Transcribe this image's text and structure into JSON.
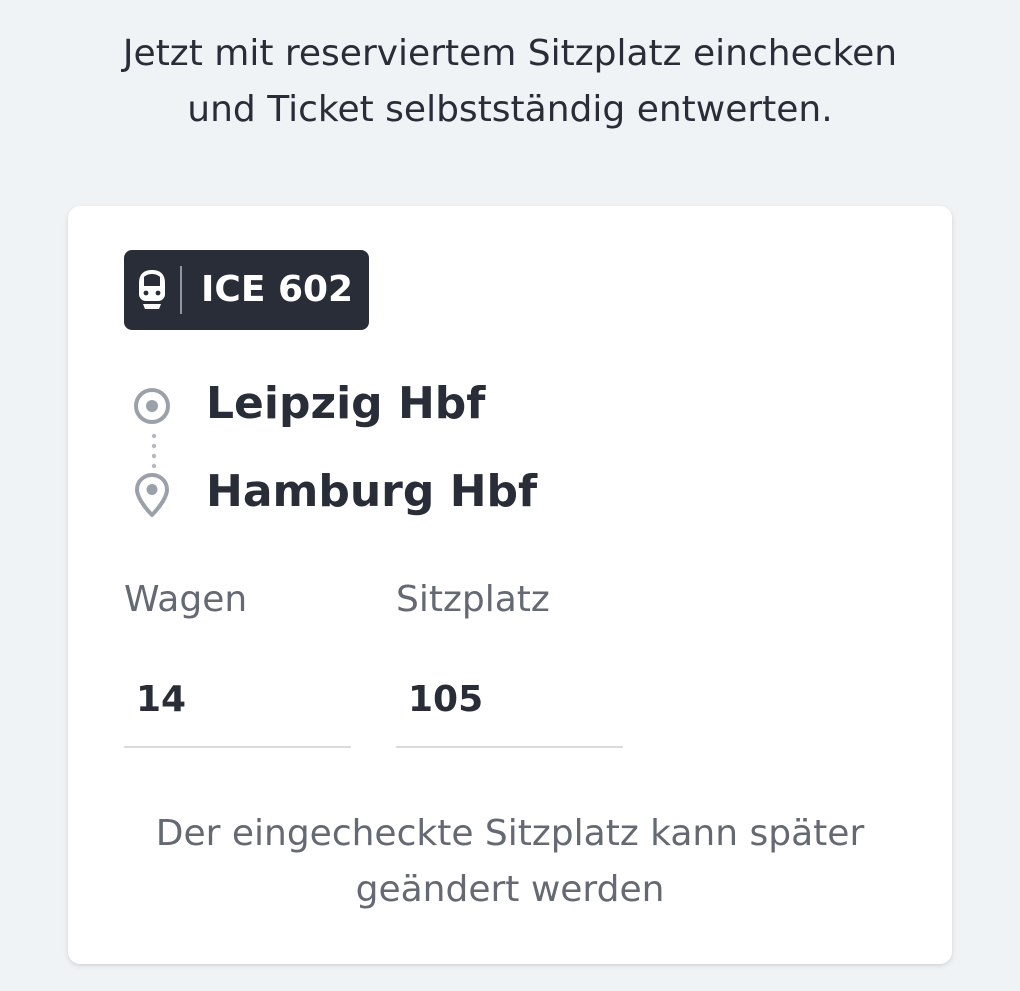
{
  "intro": {
    "line1": "Jetzt mit reserviertem Sitzplatz einchecken",
    "line2": "und Ticket selbstständig entwerten."
  },
  "card": {
    "train": {
      "icon": "train-front-icon",
      "name": "ICE 602"
    },
    "route": {
      "origin_icon": "origin-circle-icon",
      "origin": "Leipzig Hbf",
      "destination_icon": "location-pin-icon",
      "destination": "Hamburg Hbf"
    },
    "wagen": {
      "label": "Wagen",
      "value": "14"
    },
    "seat": {
      "label": "Sitzplatz",
      "value": "105"
    },
    "footnote": {
      "line1": "Der eingecheckte Sitzplatz kann später",
      "line2": "geändert werden"
    }
  },
  "colors": {
    "background": "#f0f3f5",
    "card": "#ffffff",
    "badge": "#282d37",
    "text": "#282d37",
    "muted_text": "#646973",
    "icon_gray": "#9ba1aa",
    "field_underline": "#d7dce1"
  }
}
